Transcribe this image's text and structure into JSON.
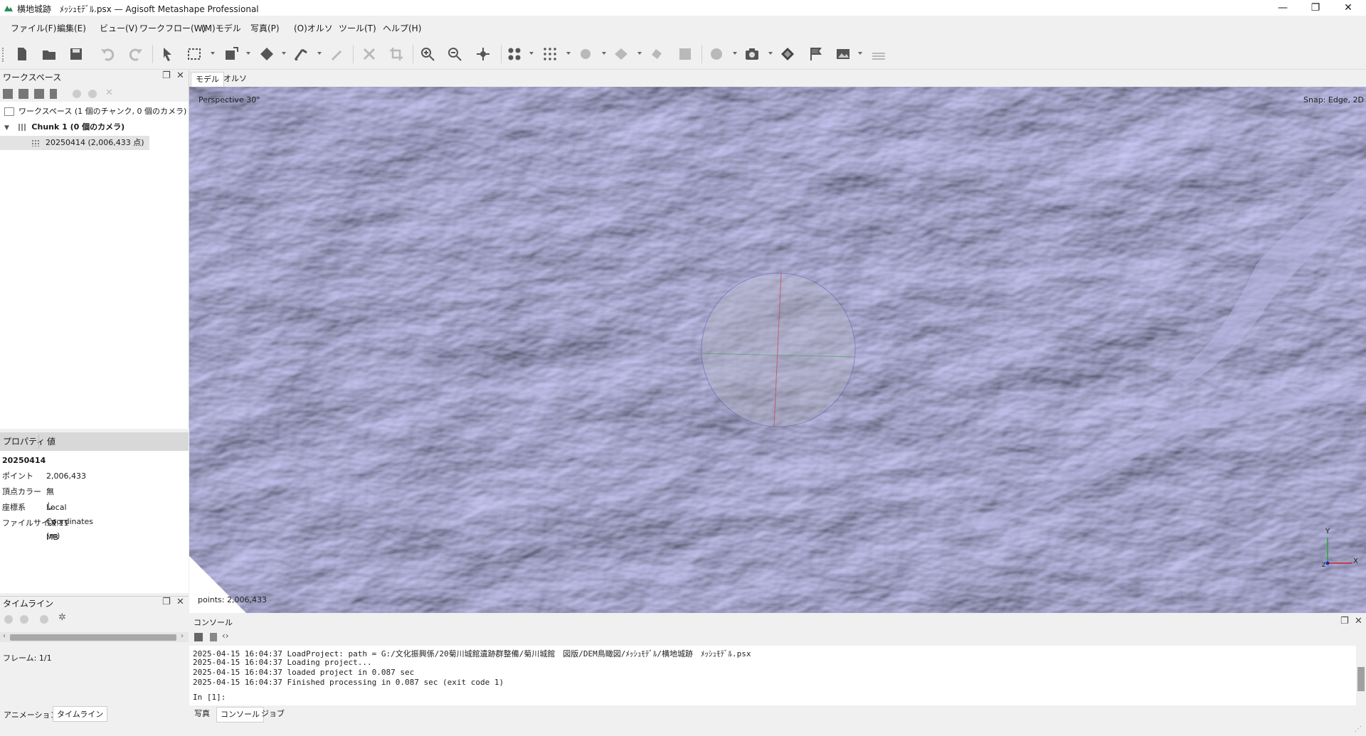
{
  "window": {
    "title": "横地城跡　ﾒｯｼｭﾓﾃﾞﾙ.psx — Agisoft Metashape Professional",
    "minimize": "—",
    "maximize": "❐",
    "close": "✕"
  },
  "menu": [
    "ファイル(F)",
    "編集(E)",
    "ビュー(V)",
    "ワークフロー(W)",
    "(M)モデル",
    "写真(P)",
    "(O)オルソ",
    "ツール(T)",
    "ヘルプ(H)"
  ],
  "workspace": {
    "title": "ワークスペース",
    "root": "ワークスペース (1 個のチャンク, 0 個のカメラ)",
    "chunk": "Chunk 1 (0 個のカメラ)",
    "item": "20250414 (2,006,433 点)"
  },
  "properties": {
    "col_property": "プロパティ",
    "col_value": "値",
    "name": "20250414",
    "rows": [
      {
        "key": "ポイント",
        "value": "2,006,433"
      },
      {
        "key": "頂点カラー",
        "value": "無し"
      },
      {
        "key": "座標系",
        "value": "Local Coordinates (m)"
      },
      {
        "key": "ファイルサイズ",
        "value": "19.11 MB"
      }
    ]
  },
  "timeline": {
    "title": "タイムライン",
    "frame": "フレーム: 1/1",
    "tab_animation": "アニメーション",
    "tab_timeline": "タイムライン"
  },
  "viewport": {
    "tab_model": "モデル",
    "tab_ortho": "オルソ",
    "perspective": "Perspective 30°",
    "snap": "Snap: Edge, 2D",
    "points": "points: 2,006,433",
    "axis_x": "X",
    "axis_y": "Y",
    "axis_z": "Z",
    "colors": {
      "terrain": "#8e8ec6",
      "terrain_dark": "#5a5a92",
      "terrain_light": "#b6b6e2"
    }
  },
  "console": {
    "title": "コンソール",
    "lines": [
      "2025-04-15 16:04:37 LoadProject: path = G:/文化振興係/20菊川城館遺跡群整備/菊川城館　図版/DEM鳥瞰図/ﾒｯｼｭﾓﾃﾞﾙ/横地城跡　ﾒｯｼｭﾓﾃﾞﾙ.psx",
      "2025-04-15 16:04:37 Loading project...",
      "2025-04-15 16:04:37 loaded project in 0.087 sec",
      "2025-04-15 16:04:37 Finished processing in 0.087 sec (exit code 1)"
    ],
    "prompt": "In [1]:",
    "tab_photos": "写真",
    "tab_console": "コンソール",
    "tab_jobs": "ジョブ"
  }
}
